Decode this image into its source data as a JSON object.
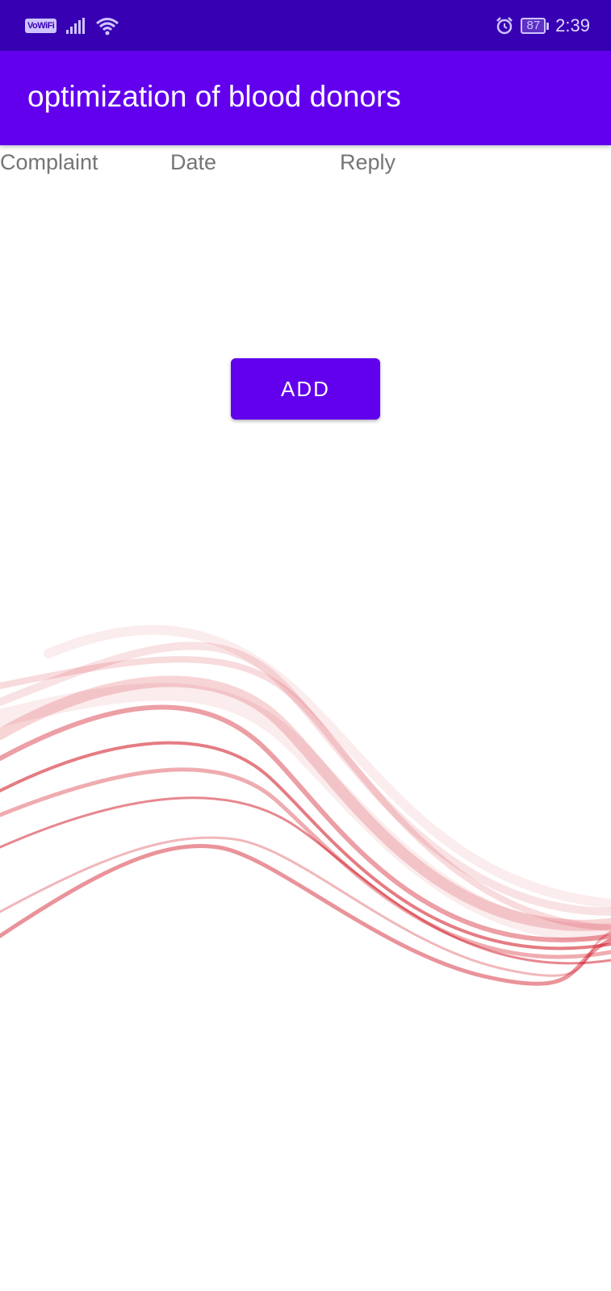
{
  "status_bar": {
    "wifi_calling_label": "VoWiFi",
    "battery_level": "87",
    "time": "2:39",
    "background_color": "#3700b3",
    "icons": [
      "signal-bars-icon",
      "wifi-icon",
      "alarm-icon",
      "battery-icon"
    ]
  },
  "app_bar": {
    "title": "optimization of blood donors",
    "background_color": "#6200ee"
  },
  "table": {
    "columns": [
      "Complaint",
      "Date",
      "Reply"
    ],
    "rows": []
  },
  "actions": {
    "add_label": "ADD"
  },
  "decoration": {
    "wave_color": "#d0101e"
  }
}
